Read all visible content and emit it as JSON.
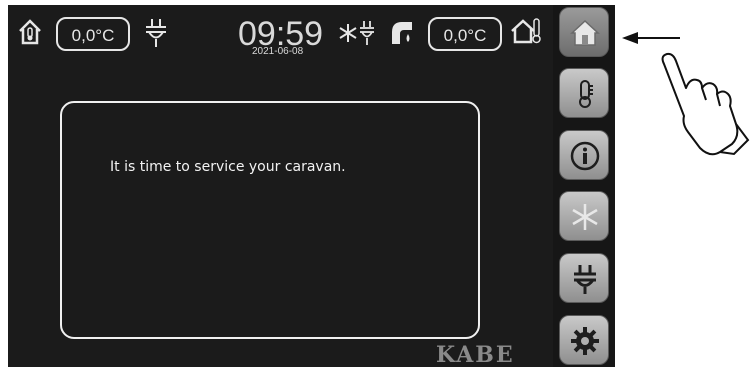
{
  "status_bar": {
    "inside_temp": "0,0°C",
    "clock": "09:59",
    "date": "2021-06-08",
    "outside_temp": "0,0°C"
  },
  "message": {
    "text": "It is time to service your caravan."
  },
  "brand": "KABE",
  "side_panel": {
    "buttons": [
      {
        "icon": "home-icon",
        "active": true
      },
      {
        "icon": "thermometer-icon"
      },
      {
        "icon": "info-icon"
      },
      {
        "icon": "snowflake-icon"
      },
      {
        "icon": "power-plug-icon"
      },
      {
        "icon": "gear-icon"
      }
    ]
  },
  "colors": {
    "screen_bg": "#1b1b1b",
    "text": "#f2f2f2",
    "button": "#b0b0b0"
  }
}
